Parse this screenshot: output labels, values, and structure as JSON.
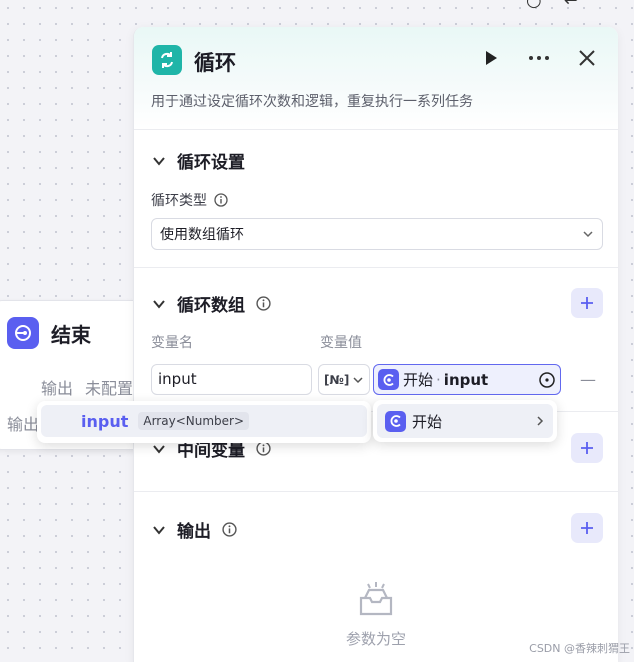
{
  "canvas": {
    "end_node": {
      "title": "结束",
      "output_label": "输出",
      "output_value": "未配置",
      "output_label_2": "输出"
    }
  },
  "panel": {
    "title": "循环",
    "description": "用于通过设定循环次数和逻辑，重复执行一系列任务",
    "sections": {
      "settings": {
        "title": "循环设置",
        "type_label": "循环类型",
        "type_value": "使用数组循环"
      },
      "array": {
        "title": "循环数组",
        "col_name": "变量名",
        "col_value": "变量值",
        "var_name": "input",
        "type_badge": "[№]",
        "ref_node": "开始",
        "ref_sep": "·",
        "ref_var": "input",
        "remove": "—"
      },
      "middle": {
        "title": "中间变量"
      },
      "output": {
        "title": "输出",
        "empty_text": "参数为空"
      }
    }
  },
  "popover": {
    "var_name": "input",
    "var_type": "Array<Number>",
    "node_name": "开始"
  },
  "watermark": "CSDN @香辣刺猬王",
  "colors": {
    "accent": "#5a5ff0",
    "loop": "#1fb5a8"
  }
}
